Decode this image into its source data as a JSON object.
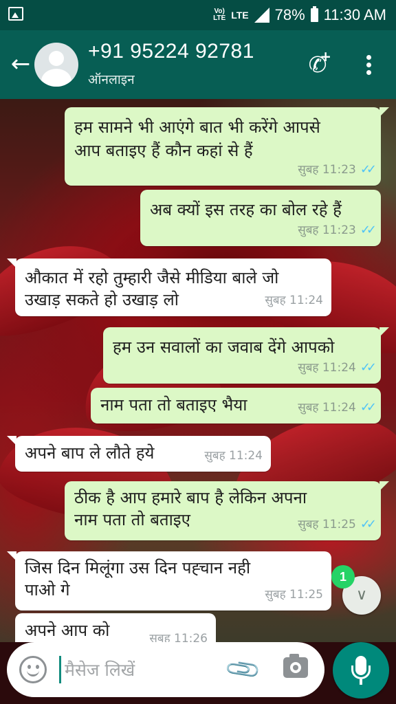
{
  "status_bar": {
    "volte_label": "Vo)\nLTE",
    "network_label": "LTE",
    "battery": "78%",
    "time": "11:30 AM"
  },
  "header": {
    "contact_name": "+91 95224 92781",
    "contact_status": "ऑनलाइन",
    "icons": [
      "back-arrow-icon",
      "avatar",
      "add-call-icon",
      "more-vert-icon"
    ]
  },
  "messages": [
    {
      "direction": "out",
      "text": "हम सामने भी आएंगे बात भी करेंगे आपसे\nआप बताइए हैं कौन कहां से हैं",
      "time": "सुबह 11:23",
      "read": true
    },
    {
      "direction": "out",
      "text": "अब क्यों इस तरह का बोल रहे हैं",
      "time": "सुबह 11:23",
      "read": true
    },
    {
      "direction": "in",
      "text": "औकात में रहो तुम्हारी जैसे मीडिया बाले जो\nउखाड़ सकते हो उखाड़ लो",
      "time": "सुबह 11:24"
    },
    {
      "direction": "out",
      "text": "हम उन सवालों का जवाब देंगे आपको",
      "time": "सुबह 11:24",
      "read": true
    },
    {
      "direction": "out",
      "text": "नाम पता तो बताइए भैया",
      "time": "सुबह 11:24",
      "read": true
    },
    {
      "direction": "in",
      "text": "अपने बाप ले  लौते हये",
      "time": "सुबह 11:24"
    },
    {
      "direction": "out",
      "text": "ठीक है आप हमारे बाप है लेकिन अपना\nनाम पता तो बताइए",
      "time": "सुबह 11:25",
      "read": true
    },
    {
      "direction": "in",
      "text": "जिस दिन मिलूंगा उस दिन पह्चान नही\nपाओ गे",
      "time": "सुबह 11:25"
    },
    {
      "direction": "in",
      "text": "अपने आप को",
      "time": "सुबह 11:26"
    }
  ],
  "unread_count": "1",
  "input": {
    "placeholder": "मैसेज लिखें",
    "value": ""
  },
  "colors": {
    "header": "#075e54",
    "status_bar": "#054d44",
    "outgoing_bubble": "#dcf8c6",
    "incoming_bubble": "#ffffff",
    "read_ticks": "#4fc3f7",
    "mic_button": "#00897b",
    "badge": "#25d366"
  }
}
